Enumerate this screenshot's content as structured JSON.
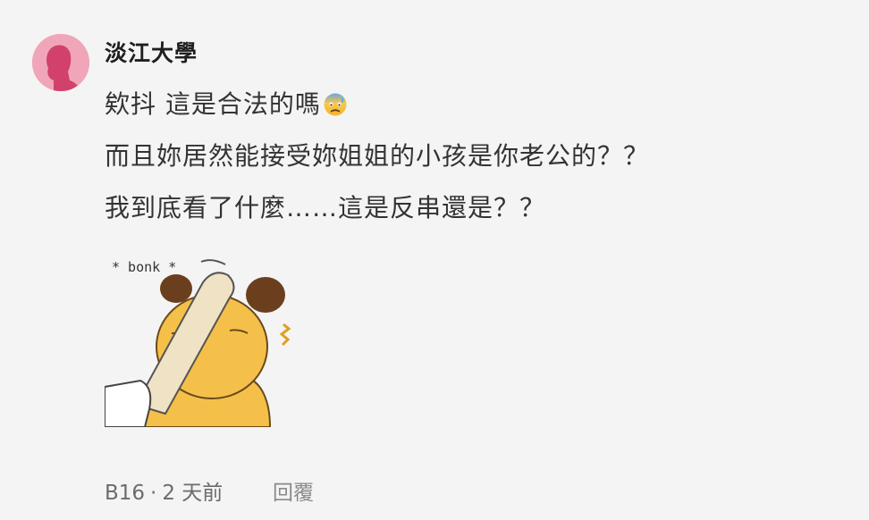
{
  "comment": {
    "author": "淡江大學",
    "lines": [
      "欸抖 這是合法的嗎",
      "而且妳居然能接受妳姐姐的小孩是你老公的？？",
      "我到底看了什麼……這是反串還是？？"
    ],
    "line1_emoji": "anxious-face-with-sweat-icon",
    "sticker_caption": "* bonk *",
    "floor": "B16",
    "separator": "·",
    "time": "2 天前",
    "reply_label": "回覆"
  },
  "colors": {
    "avatar_bg": "#f0a6b8",
    "avatar_silhouette": "#d2416c",
    "bear_fill": "#f5c04a"
  }
}
